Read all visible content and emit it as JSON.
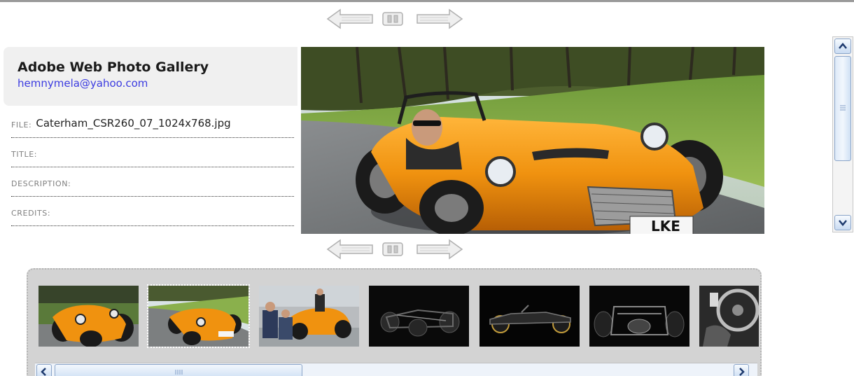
{
  "gallery": {
    "title": "Adobe Web Photo Gallery",
    "email": "hemnymela@yahoo.com"
  },
  "metadata": [
    {
      "label": "FILE:",
      "value": "Caterham_CSR260_07_1024x768.jpg"
    },
    {
      "label": "TITLE:",
      "value": ""
    },
    {
      "label": "DESCRIPTION:",
      "value": ""
    },
    {
      "label": "CREDITS:",
      "value": ""
    }
  ],
  "main_photo": {
    "plate_text": "LKE"
  },
  "icons": {
    "prev": "arrow-left-icon",
    "pause": "pause-icon",
    "next": "arrow-right-icon",
    "scroll_up": "chevron-up-icon",
    "scroll_down": "chevron-down-icon",
    "scroll_left": "chevron-left-icon",
    "scroll_right": "chevron-right-icon"
  },
  "thumbnails": {
    "count": 7,
    "selected_index": 1
  },
  "colors": {
    "email_link": "#3b3be0",
    "header_bg": "#f0f0f0",
    "strip_bg": "#d3d3d3",
    "car_orange": "#f0920f"
  }
}
